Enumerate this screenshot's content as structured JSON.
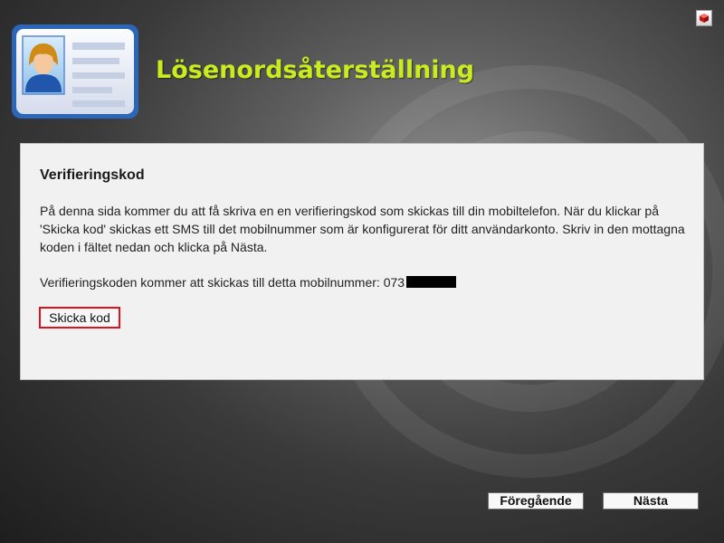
{
  "header": {
    "title": "Lösenordsåterställning",
    "app_icon": "contact-card-icon",
    "corner_icon": "app-cube-icon"
  },
  "panel": {
    "heading": "Verifieringskod",
    "description": "På denna sida kommer du att få skriva en en verifieringskod som skickas till din mobiltelefon. När du klickar på 'Skicka kod' skickas ett SMS till det mobilnummer som är konfigurerat för ditt användarkonto. Skriv in den mottagna koden i fältet nedan och klicka på Nästa.",
    "mobile_prefix": "Verifieringskoden kommer att skickas till detta mobilnummer: 073",
    "send_button_label": "Skicka kod"
  },
  "nav": {
    "prev_label": "Föregående",
    "next_label": "Nästa"
  },
  "colors": {
    "title": "#c8ec1e",
    "highlight_border": "#e0101c",
    "panel_background": "#f1f1f1"
  }
}
